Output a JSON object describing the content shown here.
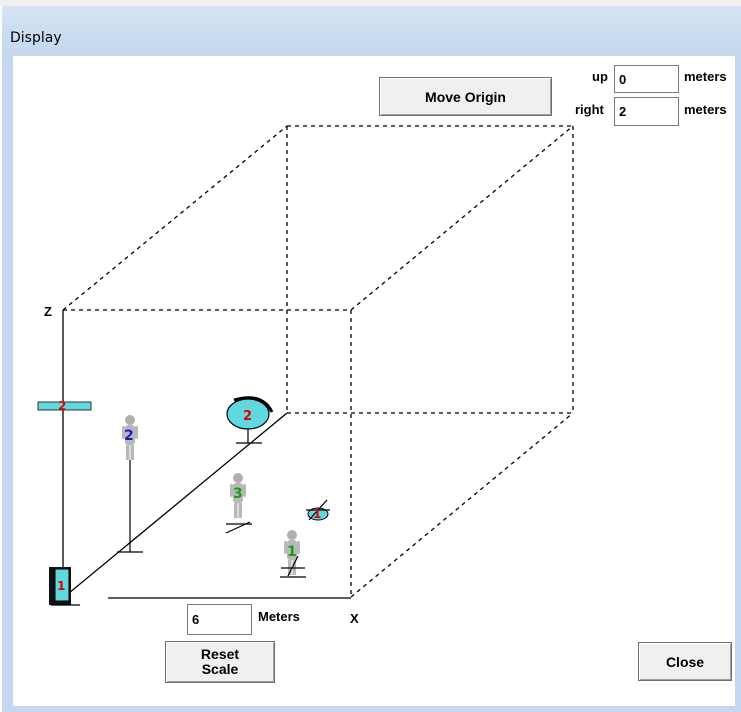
{
  "window": {
    "title": "Display"
  },
  "controls": {
    "move_origin_label": "Move Origin",
    "up_label": "up",
    "up_value": "0",
    "up_unit": "meters",
    "right_label": "right",
    "right_value": "2",
    "right_unit": "meters",
    "scale_value": "6",
    "scale_unit": "Meters",
    "reset_scale_line1": "Reset",
    "reset_scale_line2": "Scale",
    "close_label": "Close"
  },
  "axes": {
    "z_label": "Z",
    "x_label": "X"
  },
  "markers": {
    "display_1": "1",
    "screen_2": "2",
    "dish_2": "2",
    "person_2": "2",
    "person_3": "3",
    "person_1": "1",
    "antenna_1": "1"
  },
  "colors": {
    "red": "#e00000",
    "blue": "#1a1acc",
    "green": "#1a9a1a",
    "cyan": "#5fd8e0"
  }
}
